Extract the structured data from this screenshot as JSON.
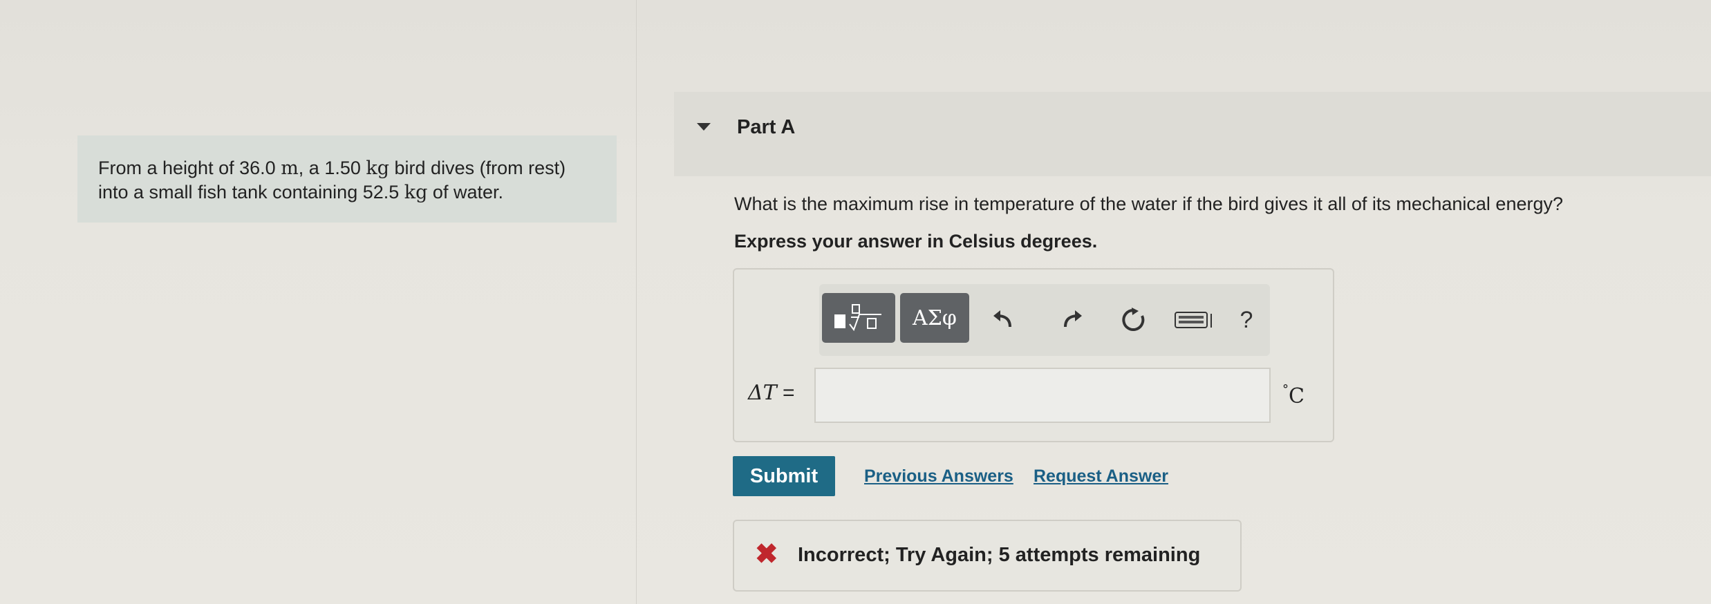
{
  "problem": {
    "text_1": "From a height of ",
    "height_value": "36.0",
    "height_unit": "m",
    "text_2": ", a 1.50 ",
    "mass_unit": "kg",
    "text_3": " bird dives (from rest)",
    "text_4": "into a small fish tank containing 52.5 ",
    "water_unit": "kg",
    "text_5": " of water."
  },
  "part": {
    "title": "Part A",
    "question": "What is the maximum rise in temperature of the water if the bird gives it all of its mechanical energy?",
    "instruction": "Express your answer in Celsius degrees."
  },
  "toolbar": {
    "greek_label": "ΑΣφ",
    "help_label": "?",
    "icons": [
      "templates-icon",
      "greek-letters",
      "undo-icon",
      "redo-icon",
      "reset-icon",
      "keyboard-icon",
      "help-icon"
    ]
  },
  "answer": {
    "variable_label": "ΔT",
    "equals": " =",
    "input_value": "",
    "unit_degree": "°",
    "unit_letter": "C"
  },
  "actions": {
    "submit_label": "Submit",
    "previous_answers_label": "Previous Answers",
    "request_answer_label": "Request Answer"
  },
  "feedback": {
    "icon": "x-icon",
    "text": "Incorrect; Try Again; 5 attempts remaining",
    "color": "#c0272d"
  },
  "colors": {
    "submit": "#1f6b86",
    "link": "#1a5f85"
  }
}
